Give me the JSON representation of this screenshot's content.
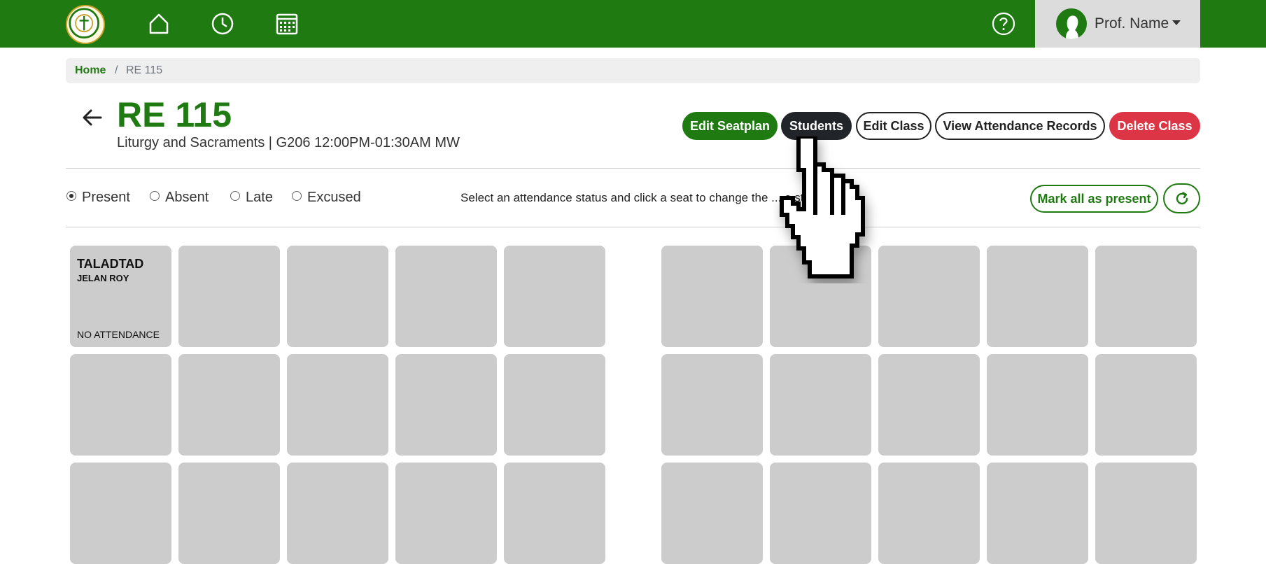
{
  "navbar": {
    "logo_icon": "school-seal-logo",
    "icons": [
      "home-icon",
      "clock-icon",
      "calendar-icon"
    ],
    "help_icon": "question-circle-icon",
    "profile": {
      "name": "Prof. Name",
      "avatar_icon": "user-silhouette-icon"
    }
  },
  "breadcrumb": {
    "home": "Home",
    "separator": "/",
    "current": "RE 115"
  },
  "header": {
    "title": "RE 115",
    "subtitle": "Liturgy and Sacraments | G206 12:00PM-01:30AM MW"
  },
  "actions": {
    "edit_seatplan": "Edit Seatplan",
    "students": "Students",
    "edit_class": "Edit Class",
    "view_records": "View Attendance Records",
    "delete_class": "Delete Class"
  },
  "statuses": {
    "selected": "Present",
    "options": [
      "Present",
      "Absent",
      "Late",
      "Excused"
    ]
  },
  "instructions": "Select an attendance status and click a seat to change the  ...  e status.",
  "mark_all": "Mark all as present",
  "refresh_icon": "refresh-icon",
  "seats": [
    {
      "last": "TALADTAD",
      "first": "JELAN ROY",
      "status": "NO ATTENDANCE"
    }
  ],
  "colors": {
    "primary": "#1f7a12",
    "dark": "#212529",
    "danger": "#dc3545",
    "seat": "#cccccc"
  }
}
